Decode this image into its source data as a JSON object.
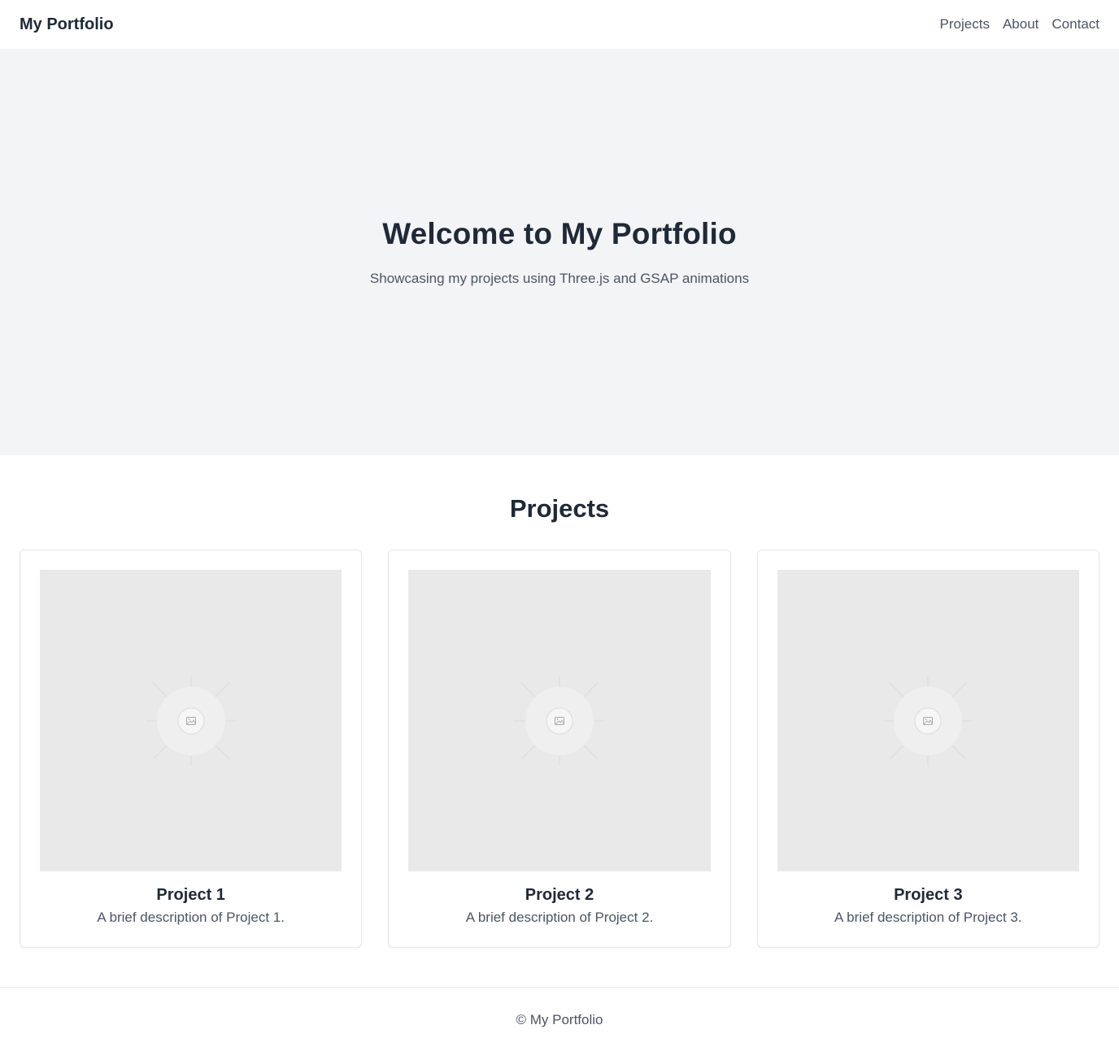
{
  "header": {
    "brand": "My Portfolio",
    "nav": [
      {
        "label": "Projects"
      },
      {
        "label": "About"
      },
      {
        "label": "Contact"
      }
    ]
  },
  "hero": {
    "title": "Welcome to My Portfolio",
    "subtitle": "Showcasing my projects using Three.js and GSAP animations"
  },
  "projects": {
    "title": "Projects",
    "items": [
      {
        "title": "Project 1",
        "description": "A brief description of Project 1.",
        "image_icon": "image-placeholder-icon"
      },
      {
        "title": "Project 2",
        "description": "A brief description of Project 2.",
        "image_icon": "image-placeholder-icon"
      },
      {
        "title": "Project 3",
        "description": "A brief description of Project 3.",
        "image_icon": "image-placeholder-icon"
      }
    ]
  },
  "footer": {
    "text": "© My Portfolio"
  },
  "colors": {
    "text_dark": "#1f2937",
    "text_muted": "#4b5563",
    "hero_bg": "#f3f4f6",
    "placeholder_bg": "#e9e9e9",
    "border": "#e5e7eb"
  }
}
